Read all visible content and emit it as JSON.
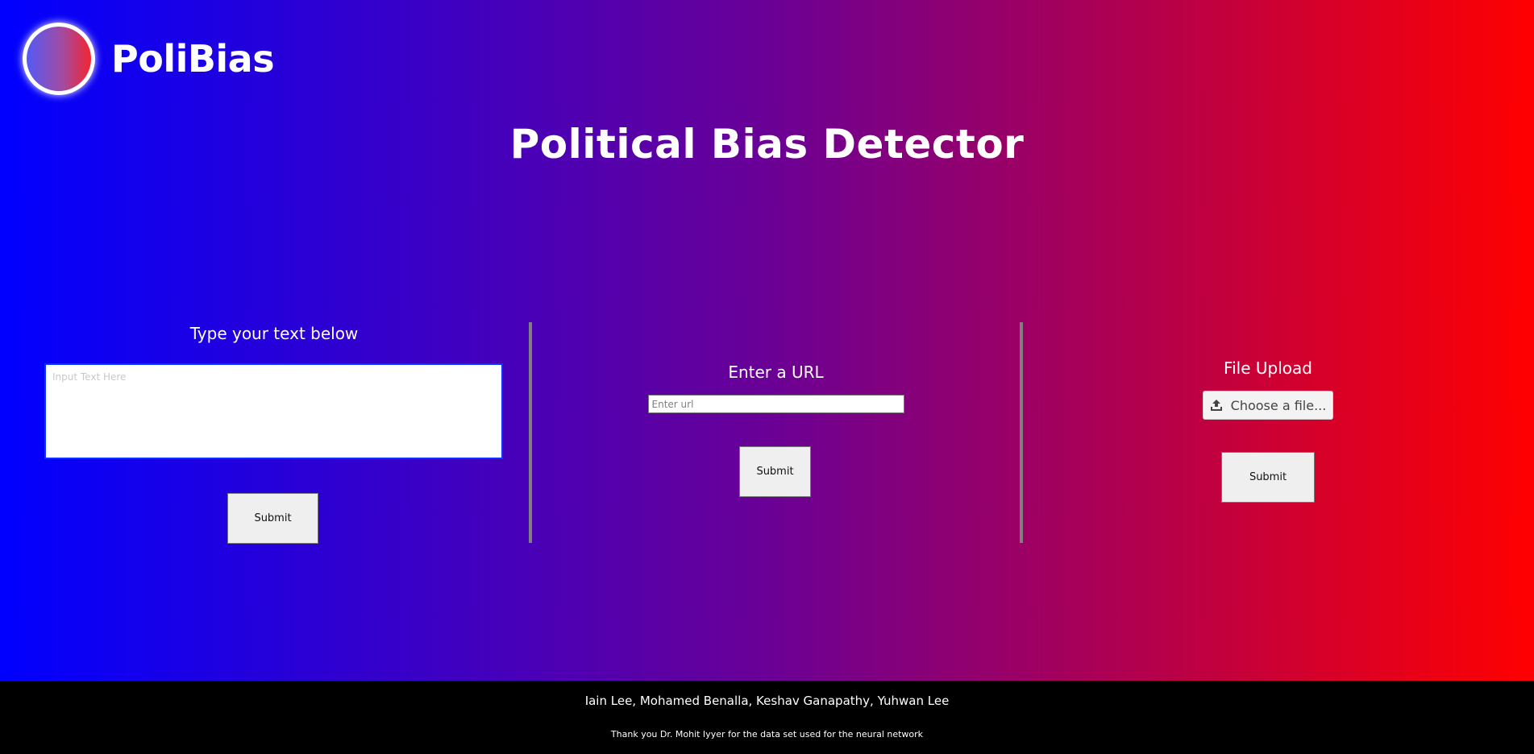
{
  "header": {
    "brand_name": "PoliBias",
    "logo": "gradient-circle-logo"
  },
  "page_title": "Political Bias Detector",
  "text_panel": {
    "heading": "Type your text below",
    "input_placeholder": "Input Text Here",
    "input_value": "",
    "submit_label": "Submit"
  },
  "url_panel": {
    "heading": "Enter a URL",
    "input_placeholder": "Enter url",
    "input_value": "",
    "submit_label": "Submit"
  },
  "file_panel": {
    "heading": "File Upload",
    "choose_label": "Choose a file...",
    "icon": "upload-icon",
    "submit_label": "Submit"
  },
  "footer": {
    "authors": "Iain Lee, Mohamed Benalla, Keshav Ganapathy, Yuhwan Lee",
    "thanks": "Thank you Dr. Mohit Iyyer for the data set used for the neural network"
  },
  "colors": {
    "gradient_left": "#0000ff",
    "gradient_mid": "#6a0096",
    "gradient_right": "#ff0000",
    "footer_bg": "#000000",
    "textarea_border": "#0a33ff"
  }
}
